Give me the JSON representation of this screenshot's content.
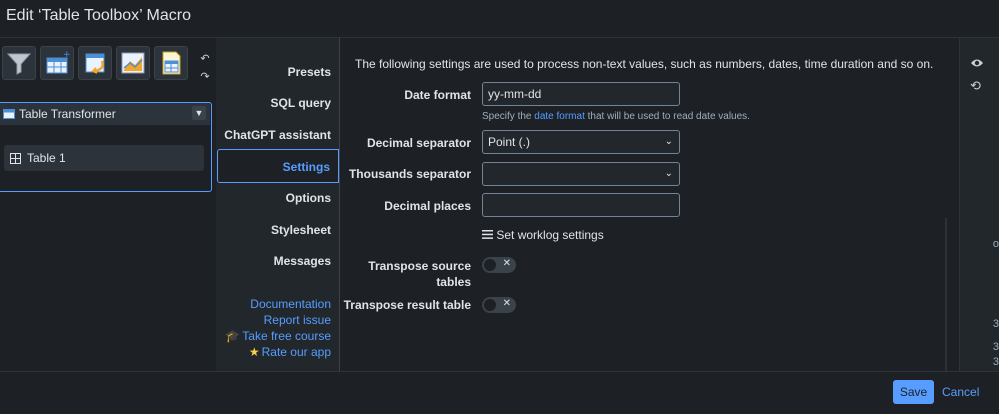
{
  "window": {
    "title": "Edit ‘Table Toolbox’ Macro"
  },
  "toolbar": {
    "tools": [
      {
        "icon": "filter-icon"
      },
      {
        "icon": "table-add-icon"
      },
      {
        "icon": "table-transform-icon"
      },
      {
        "icon": "chart-icon"
      },
      {
        "icon": "table-sheet-icon"
      }
    ],
    "undo_glyph": "↶",
    "redo_glyph": "↷"
  },
  "tree": {
    "selected": "Table Transformer",
    "items": [
      {
        "label": "Table 1"
      }
    ]
  },
  "nav": {
    "items": [
      {
        "label": "Presets"
      },
      {
        "label": "SQL query"
      },
      {
        "label": "ChatGPT assistant"
      },
      {
        "label": "Settings"
      },
      {
        "label": "Options"
      },
      {
        "label": "Stylesheet"
      },
      {
        "label": "Messages"
      }
    ],
    "active": "Settings",
    "links": [
      {
        "label": "Documentation",
        "emoji": ""
      },
      {
        "label": "Report issue",
        "emoji": ""
      },
      {
        "label": "Take free course",
        "emoji": "🎓"
      },
      {
        "label": "Rate our app",
        "emoji": "★"
      }
    ]
  },
  "settings": {
    "intro": "The following settings are used to process non-text values, such as numbers, dates, time duration and so on.",
    "date_format": {
      "label": "Date format",
      "value": "yy-mm-dd"
    },
    "hint": {
      "prefix": "Specify the ",
      "link": "date format",
      "suffix": " that will be used to read date values."
    },
    "decimal_separator": {
      "label": "Decimal separator",
      "value": "Point (.)"
    },
    "thousands_separator": {
      "label": "Thousands separator",
      "value": ""
    },
    "decimal_places": {
      "label": "Decimal places",
      "value": ""
    },
    "worklog": {
      "label": "Set worklog settings"
    },
    "transpose_source": {
      "label_1": "Transpose source",
      "label_2": "tables",
      "on": false
    },
    "transpose_result": {
      "label": "Transpose result table",
      "on": false
    }
  },
  "side": {
    "peek": [
      "o",
      "3",
      "3",
      "3"
    ]
  },
  "footer": {
    "save": "Save",
    "cancel": "Cancel"
  },
  "colors": {
    "accent": "#579dff",
    "background": "#1d2125",
    "panel": "#22272b"
  }
}
